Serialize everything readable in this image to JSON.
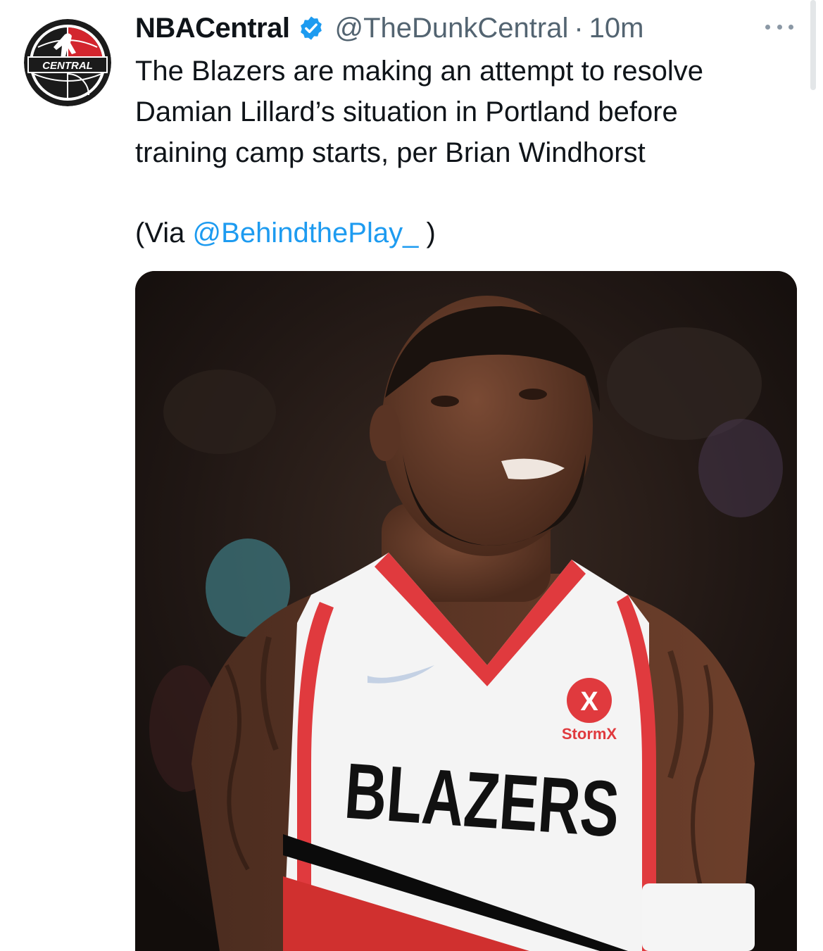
{
  "author": {
    "display_name": "NBACentral",
    "handle": "@TheDunkCentral",
    "separator": "·",
    "timestamp": "10m",
    "avatar_text": "CENTRAL",
    "verified_icon": "verified-badge-icon"
  },
  "tweet": {
    "text_lines": [
      "The Blazers are making an attempt to resolve",
      "Damian Lillard’s situation in Portland before",
      "training camp starts, per Brian Windhorst"
    ],
    "via_prefix": "(Via ",
    "via_mention": "@BehindthePlay_",
    "via_suffix": " )"
  },
  "media": {
    "jersey_text": "BLAZERS",
    "sponsor_text": "StormX",
    "sponsor_letter": "X"
  },
  "colors": {
    "link": "#1d9bf0",
    "secondary_text": "#536471",
    "verified": "#1d9bf0",
    "jersey_red": "#e03a3e"
  }
}
